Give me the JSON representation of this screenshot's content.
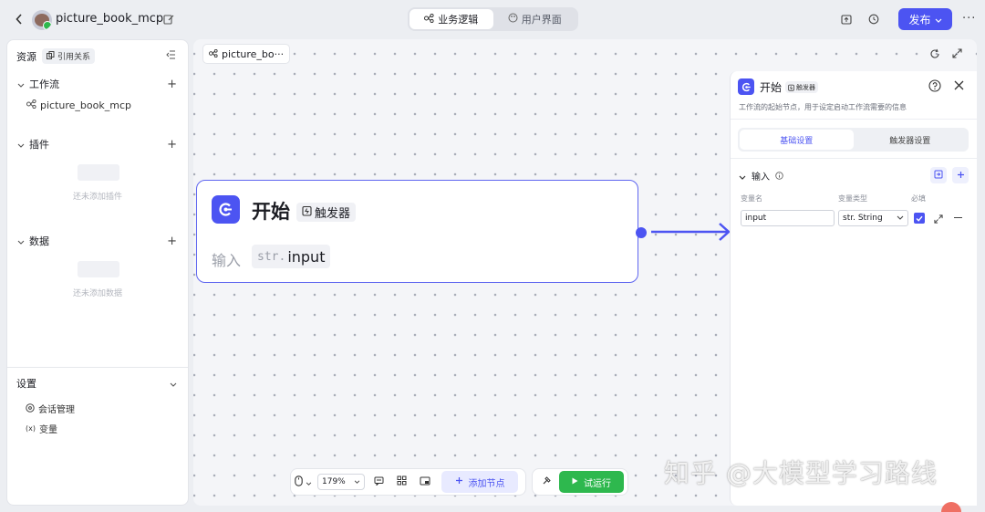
{
  "topbar": {
    "app_name": "picture_book_mcp",
    "tabs": [
      {
        "label": "业务逻辑",
        "active": true
      },
      {
        "label": "用户界面",
        "active": false
      }
    ],
    "publish_label": "发布"
  },
  "sidebar": {
    "header": "资源",
    "ref_label": "引用关系",
    "workflow": {
      "title": "工作流",
      "items": [
        "picture_book_mcp"
      ]
    },
    "plugins": {
      "title": "插件",
      "empty": "还未添加插件"
    },
    "data": {
      "title": "数据",
      "empty": "还未添加数据"
    },
    "settings": {
      "title": "设置",
      "items": [
        "会话管理",
        "变量"
      ]
    }
  },
  "canvas": {
    "tab_label": "picture_bo···",
    "node": {
      "title": "开始",
      "badge": "触发器",
      "input_label": "输入",
      "input_type": "str.",
      "input_name": "input"
    }
  },
  "panel": {
    "title": "开始",
    "badge": "触发器",
    "desc": "工作流的起始节点，用于设定启动工作流需要的信息",
    "tabs": [
      {
        "label": "基础设置",
        "active": true
      },
      {
        "label": "触发器设置",
        "active": false
      }
    ],
    "input_section": "输入",
    "col_name": "变量名",
    "col_type": "变量类型",
    "col_required": "必填",
    "row": {
      "name": "input",
      "type": "str. String",
      "required": true
    }
  },
  "bottombar": {
    "zoom": "179%",
    "add_node": "添加节点",
    "run": "试运行"
  },
  "watermark": "知乎 @大模型学习路线",
  "colors": {
    "accent": "#4c54f2",
    "run": "#2eb84e",
    "node_border": "#5f66f0"
  }
}
